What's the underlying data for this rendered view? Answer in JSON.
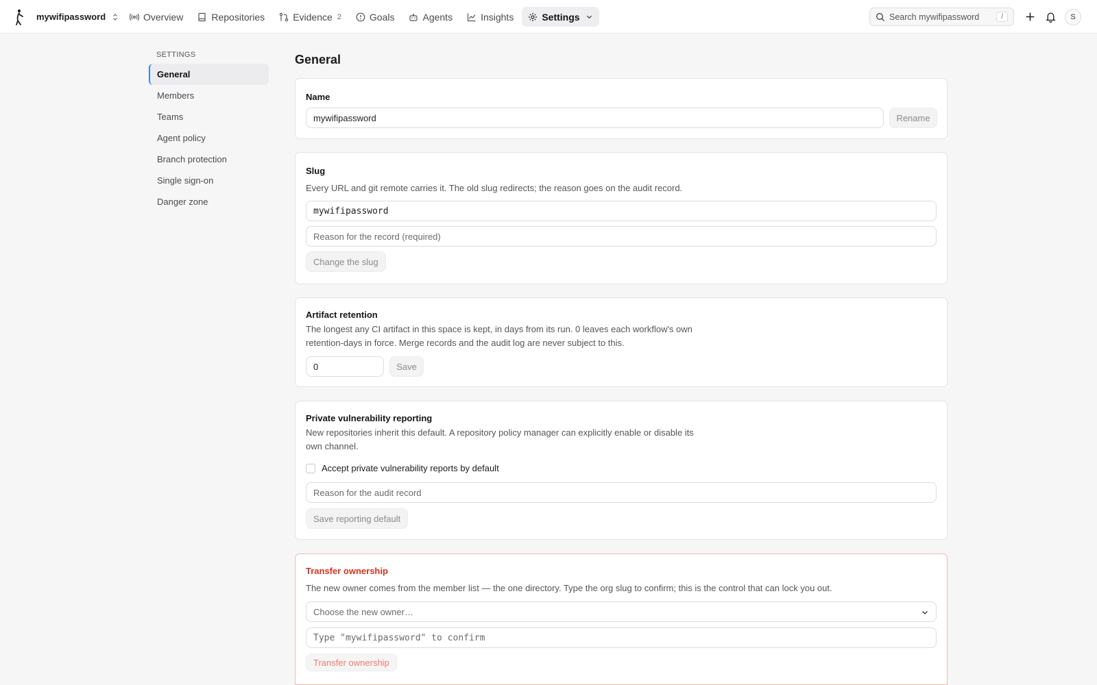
{
  "header": {
    "org_name": "mywifipassword",
    "nav": [
      {
        "label": "Overview",
        "icon": "broadcast-icon"
      },
      {
        "label": "Repositories",
        "icon": "book-icon"
      },
      {
        "label": "Evidence",
        "icon": "git-compare-icon",
        "badge": "2"
      },
      {
        "label": "Goals",
        "icon": "target-icon"
      },
      {
        "label": "Agents",
        "icon": "robot-icon"
      },
      {
        "label": "Insights",
        "icon": "chart-line-icon"
      },
      {
        "label": "Settings",
        "icon": "gear-icon",
        "active": true
      }
    ],
    "search_placeholder": "Search mywifipassword",
    "search_shortcut": "/",
    "avatar_initial": "S"
  },
  "sidebar": {
    "title": "SETTINGS",
    "items": [
      {
        "label": "General",
        "active": true
      },
      {
        "label": "Members"
      },
      {
        "label": "Teams"
      },
      {
        "label": "Agent policy"
      },
      {
        "label": "Branch protection"
      },
      {
        "label": "Single sign-on"
      },
      {
        "label": "Danger zone"
      }
    ]
  },
  "main": {
    "title": "General",
    "name_section": {
      "title": "Name",
      "value": "mywifipassword",
      "button": "Rename"
    },
    "slug_section": {
      "title": "Slug",
      "description": "Every URL and git remote carries it. The old slug redirects; the reason goes on the audit record.",
      "value": "mywifipassword",
      "reason_placeholder": "Reason for the record (required)",
      "button": "Change the slug"
    },
    "retention_section": {
      "title": "Artifact retention",
      "description_line1": "The longest any CI artifact in this space is kept, in days from its run. 0 leaves each workflow's own",
      "description_line2": "retention-days in force. Merge records and the audit log are never subject to this.",
      "value": "0",
      "button": "Save"
    },
    "vuln_section": {
      "title": "Private vulnerability reporting",
      "description_line1": "New repositories inherit this default. A repository policy manager can explicitly enable or disable its",
      "description_line2": "own channel.",
      "checkbox_label": "Accept private vulnerability reports by default",
      "reason_placeholder": "Reason for the audit record",
      "button": "Save reporting default"
    },
    "transfer_section": {
      "title": "Transfer ownership",
      "description": "The new owner comes from the member list — the one directory. Type the org slug to confirm; this is the control that can lock you out.",
      "owner_placeholder": "Choose the new owner…",
      "confirm_placeholder": "Type \"mywifipassword\" to confirm",
      "button": "Transfer ownership"
    }
  },
  "colors": {
    "accent": "#3b82f6",
    "danger": "#d6331f",
    "danger_border": "#f3b9b3"
  }
}
